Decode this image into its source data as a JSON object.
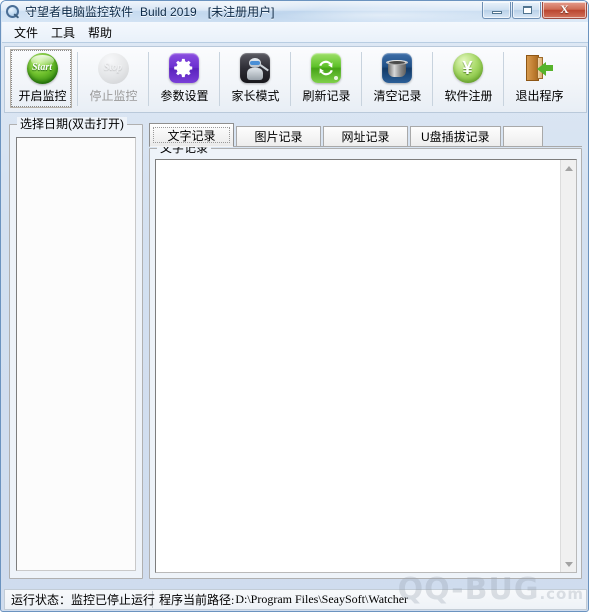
{
  "window": {
    "title_main": "守望者电脑监控软件",
    "title_build": "Build 2019",
    "title_registration": "[未注册用户]",
    "icon": "magnifier-icon",
    "buttons": {
      "minimize": "—",
      "maximize": "□",
      "close": "X"
    }
  },
  "menubar": {
    "items": [
      {
        "label": "文件"
      },
      {
        "label": "工具"
      },
      {
        "label": "帮助"
      }
    ]
  },
  "toolbar": {
    "buttons": [
      {
        "label": "开启监控",
        "icon": "start-orb-icon",
        "state": "enabled",
        "focused": true
      },
      {
        "label": "停止监控",
        "icon": "stop-orb-icon",
        "state": "disabled",
        "focused": false
      },
      {
        "label": "参数设置",
        "icon": "gear-icon",
        "state": "enabled",
        "focused": false
      },
      {
        "label": "家长模式",
        "icon": "parent-robot-icon",
        "state": "enabled",
        "focused": false
      },
      {
        "label": "刷新记录",
        "icon": "refresh-icon",
        "state": "enabled",
        "focused": false
      },
      {
        "label": "清空记录",
        "icon": "trash-icon",
        "state": "enabled",
        "focused": false
      },
      {
        "label": "软件注册",
        "icon": "yen-coin-icon",
        "state": "enabled",
        "focused": false
      },
      {
        "label": "退出程序",
        "icon": "exit-door-icon",
        "state": "enabled",
        "focused": false
      }
    ]
  },
  "date_panel": {
    "group_title": "选择日期(双击打开)",
    "items": []
  },
  "tabs": [
    {
      "label": "文字记录",
      "active": true
    },
    {
      "label": "图片记录",
      "active": false
    },
    {
      "label": "网址记录",
      "active": false
    },
    {
      "label": "U盘插拔记录",
      "active": false
    }
  ],
  "log_panel": {
    "group_title": "文字记录",
    "content": "",
    "scrollbar": {
      "up": "scroll-up-arrow",
      "down": "scroll-down-arrow"
    }
  },
  "statusbar": {
    "run_state_label": "运行状态：监控已停止运行",
    "path_label": "程序当前路径:",
    "path_value": "D:\\Program Files\\SeaySoft\\Watcher"
  },
  "watermark": {
    "text": "QQ-BUG",
    "suffix": ".com"
  },
  "colors": {
    "accent_green": "#5fc22a",
    "accent_purple": "#6b2fd0",
    "accent_blue": "#1f4f86",
    "title_gradient": "#bed4ec",
    "panel_bg": "#eef3f9"
  }
}
